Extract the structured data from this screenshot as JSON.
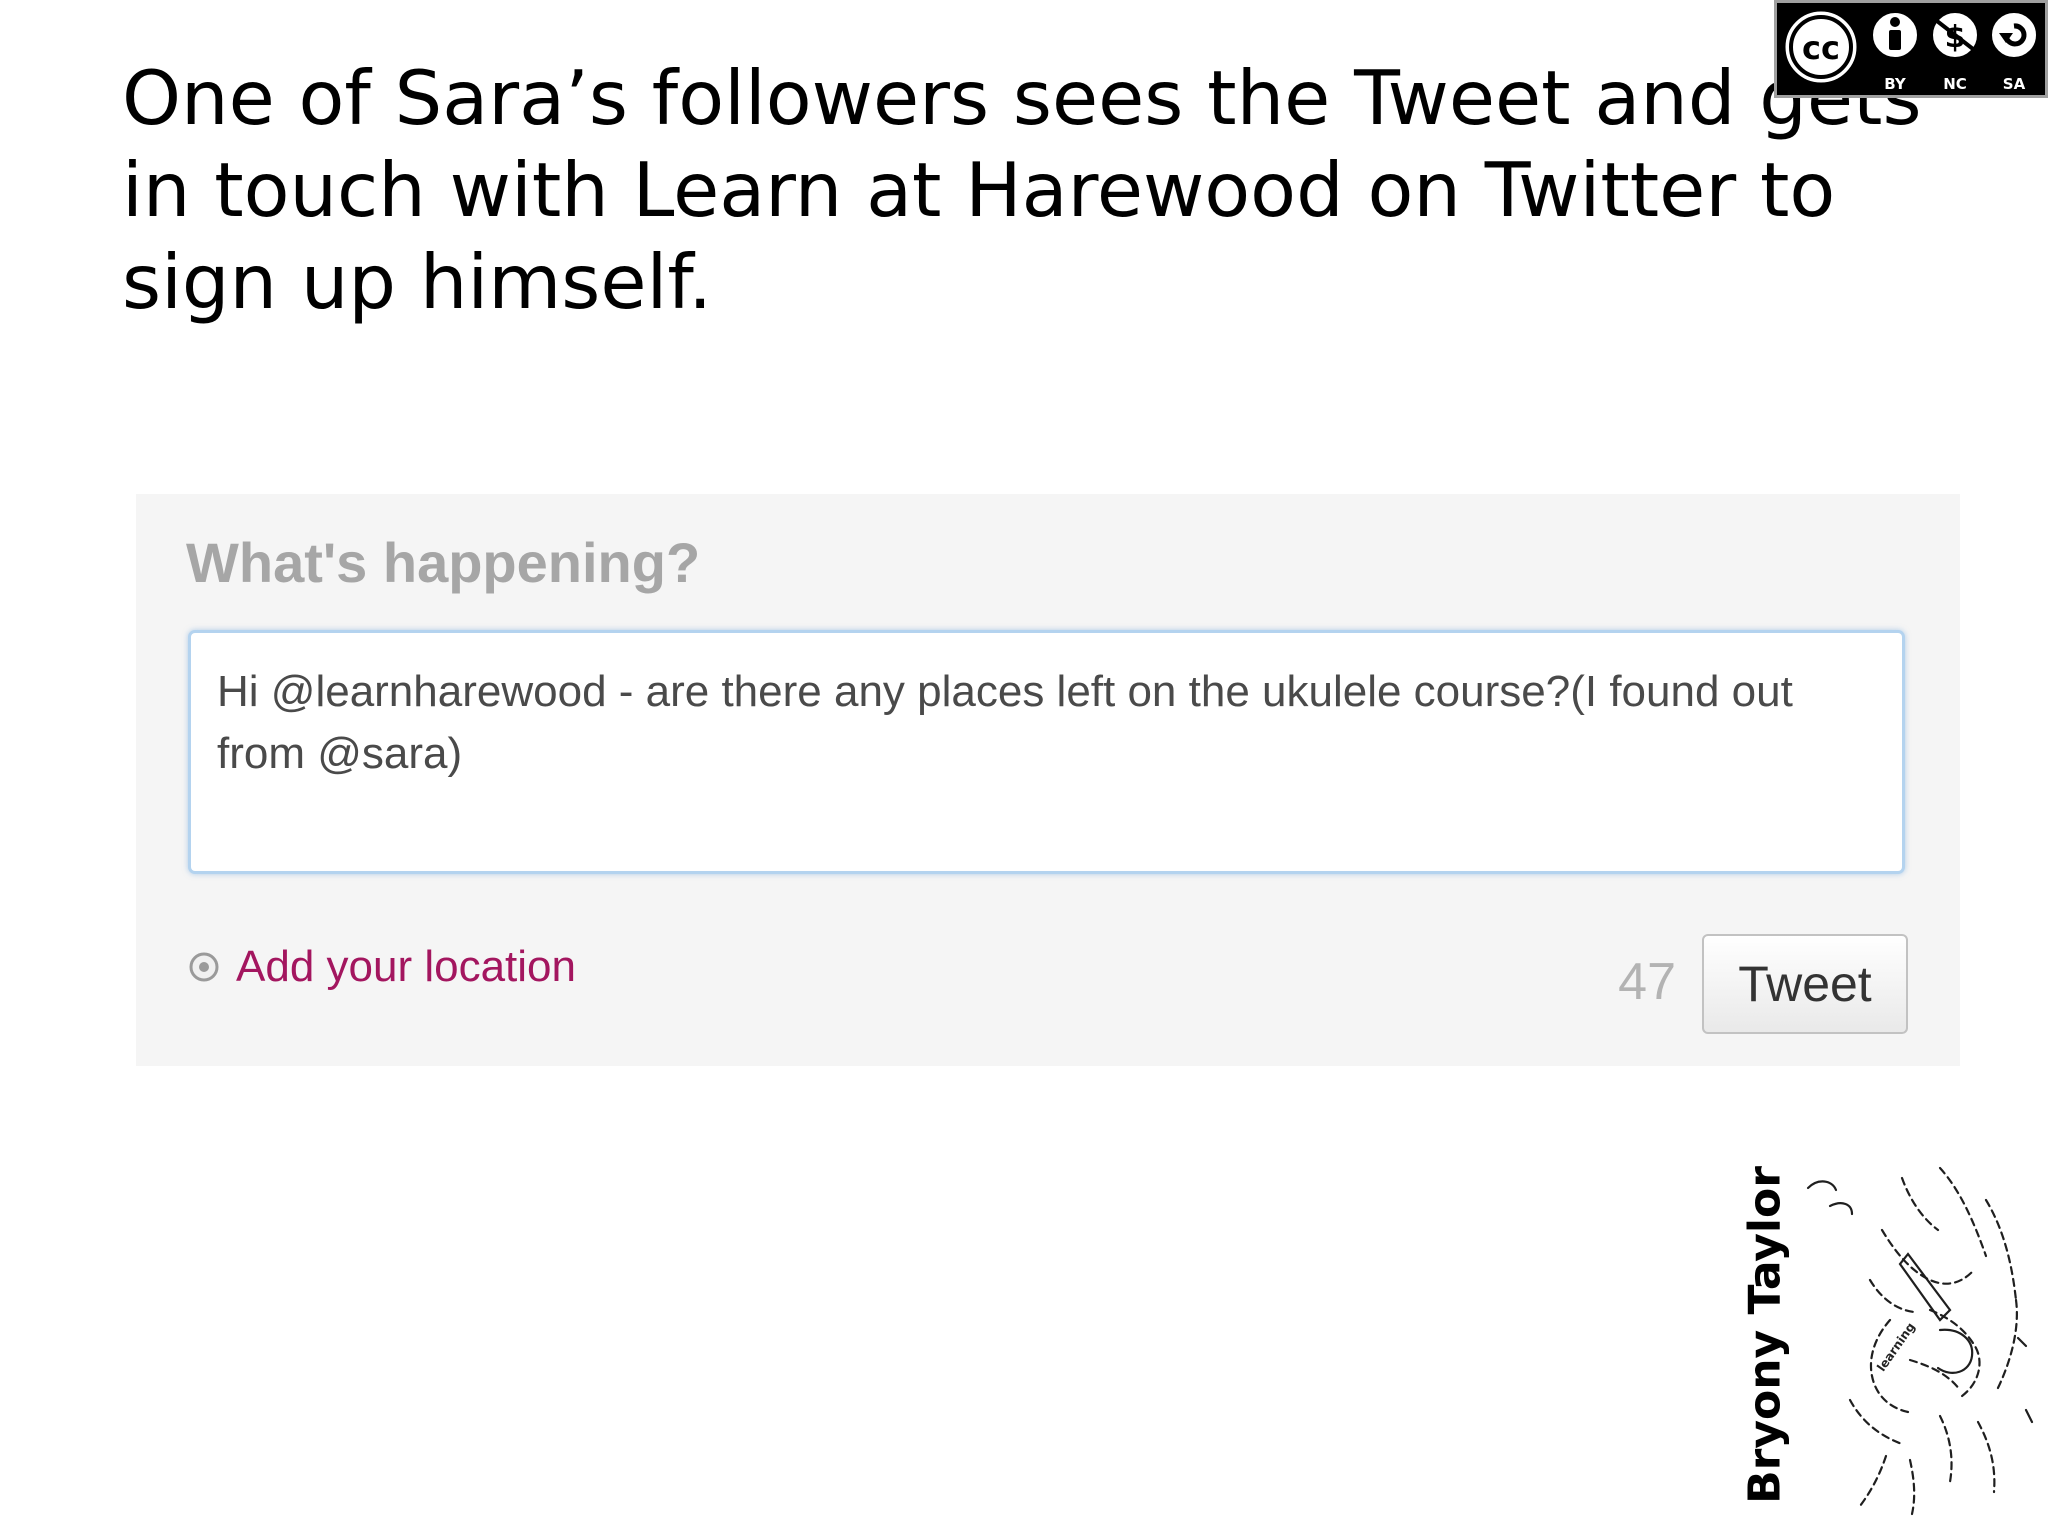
{
  "slide": {
    "title": "One of Sara’s followers sees the Tweet and gets in touch with Learn at Harewood on Twitter to sign up himself."
  },
  "license_badge": {
    "icons": [
      "cc-icon",
      "by-icon",
      "nc-icon",
      "sa-icon"
    ],
    "cc_label": "cc",
    "labels": [
      "BY",
      "NC",
      "SA"
    ]
  },
  "composer": {
    "heading": "What's happening?",
    "tweet_text": "Hi @learnharewood - are there any places left on the ukulele course?(I found out from @sara)",
    "location_label": "Add your location",
    "char_count": "47",
    "tweet_button_label": "Tweet",
    "colors": {
      "location_link": "#a3165f",
      "box_border": "#b4d3ef"
    }
  },
  "author": {
    "name": "Bryony Taylor",
    "sketch_word": "learning"
  }
}
